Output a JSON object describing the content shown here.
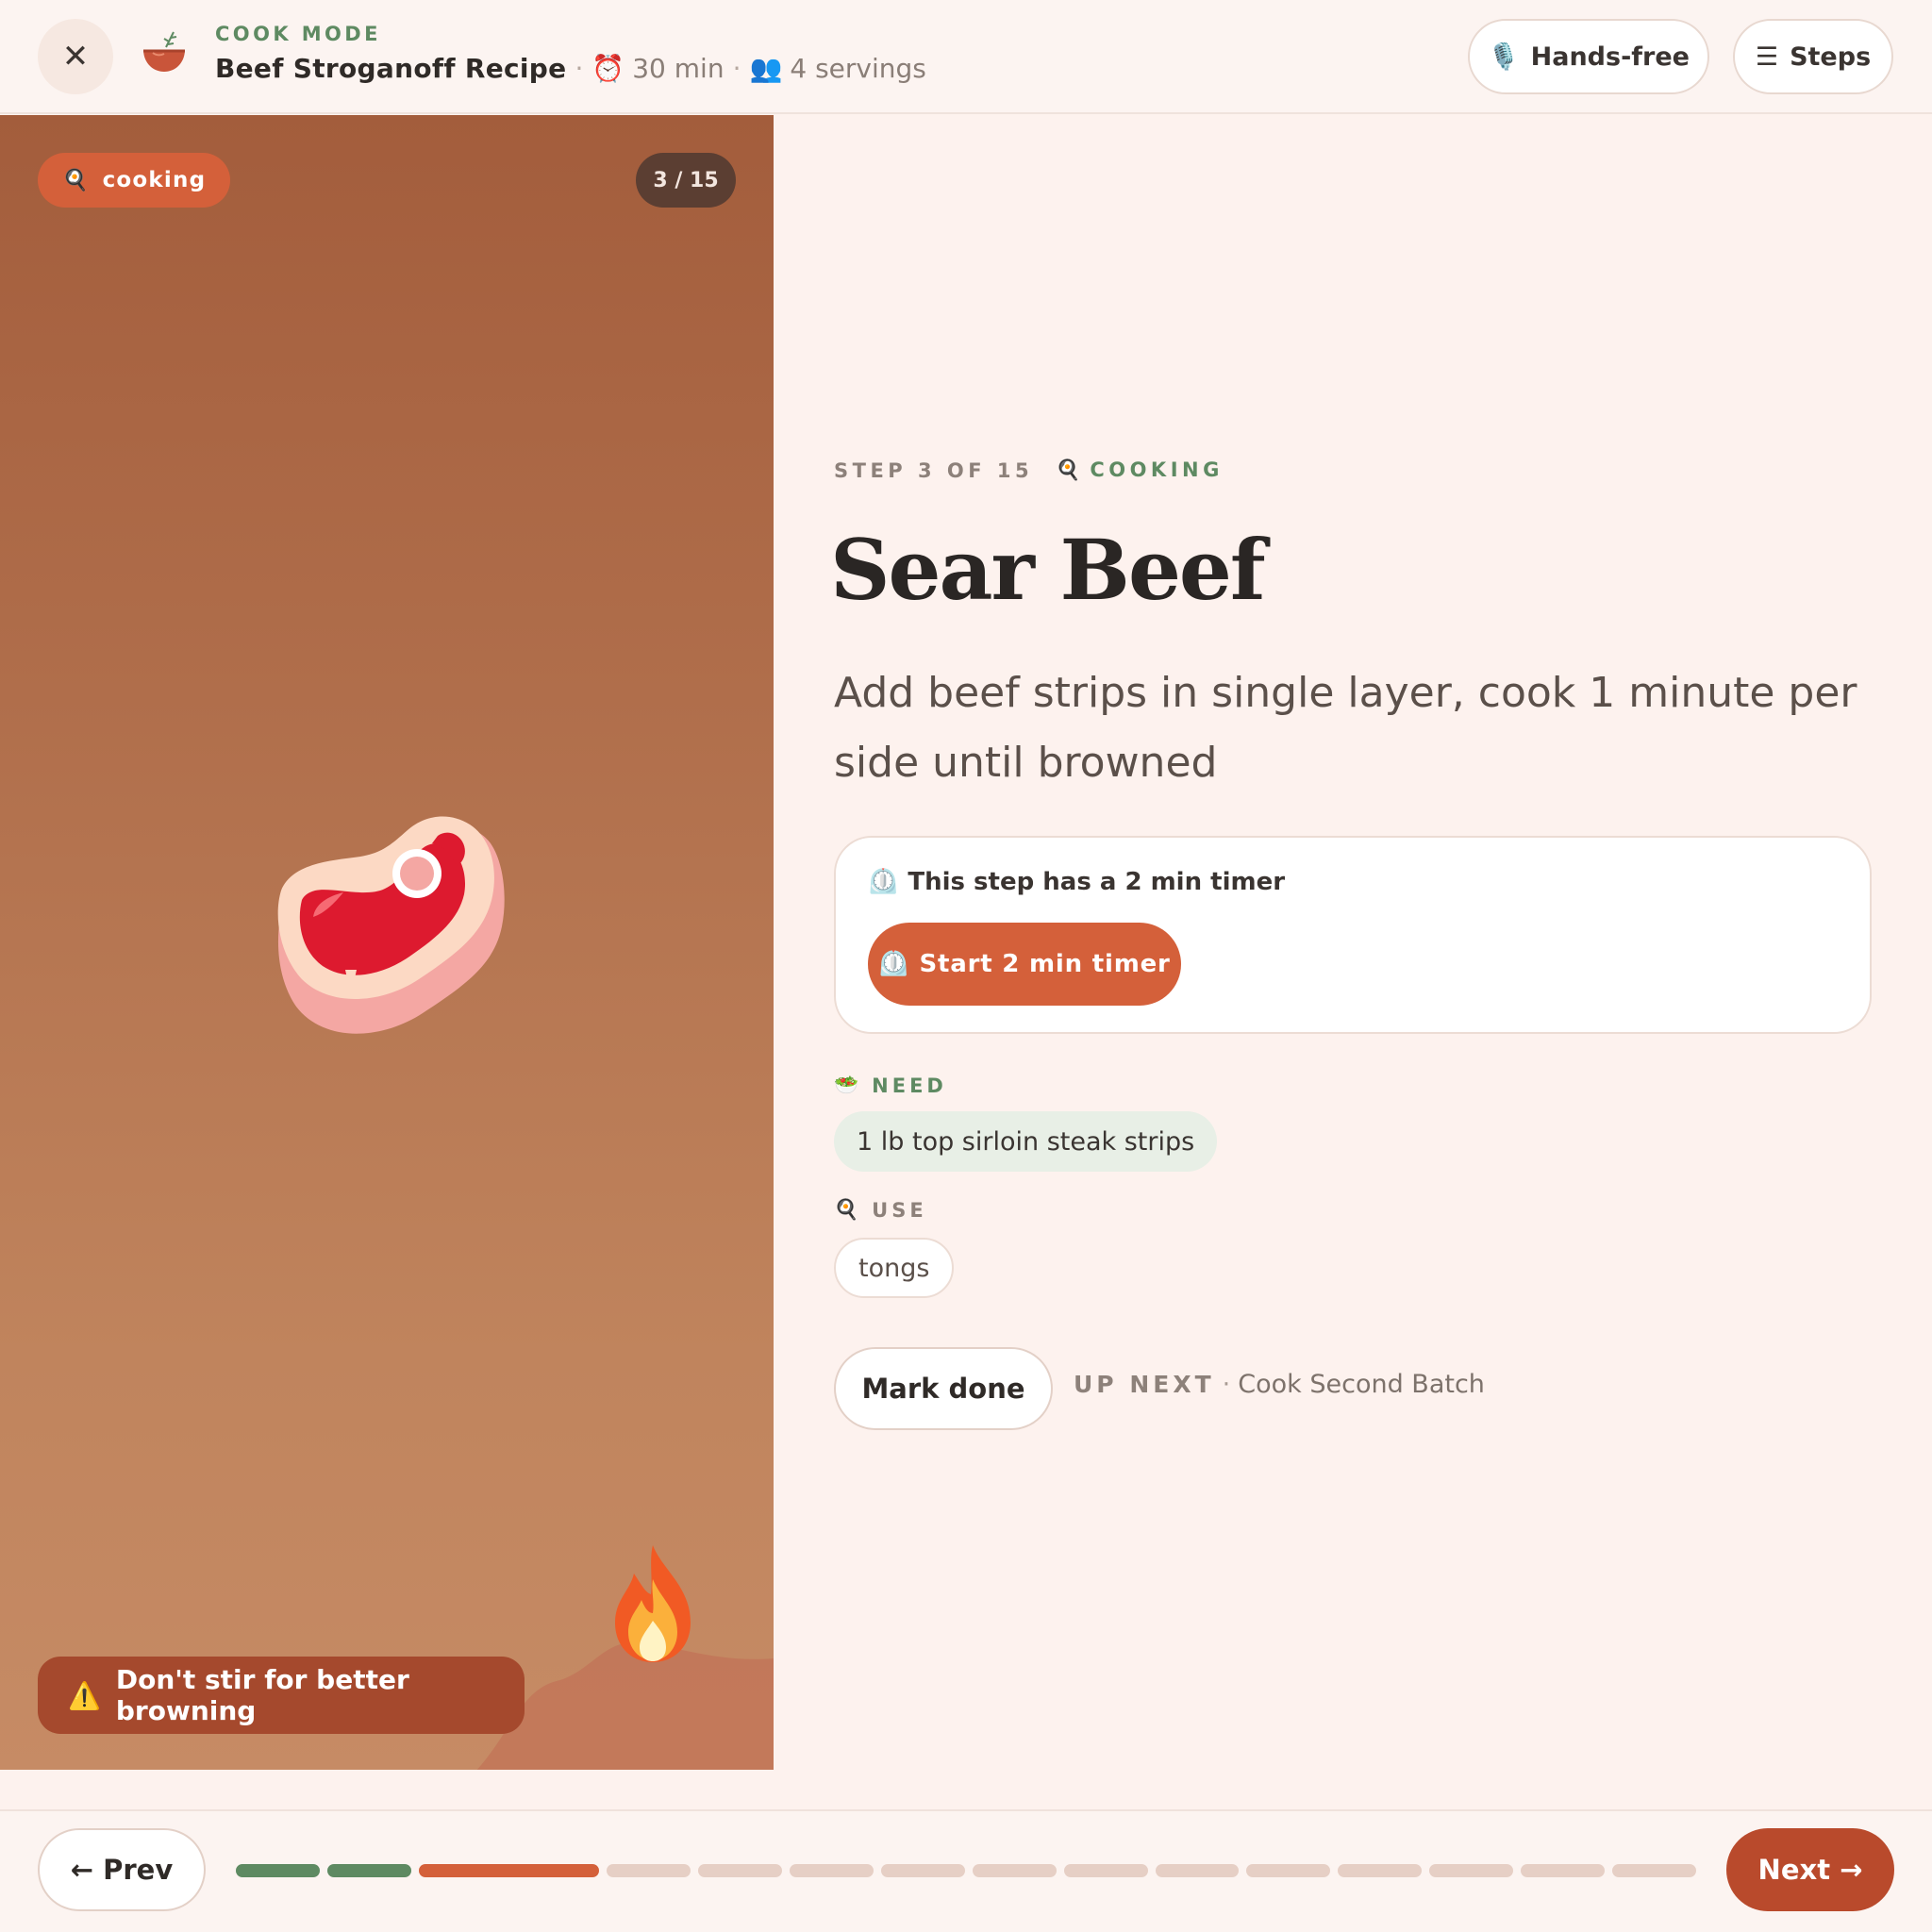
{
  "header": {
    "close_glyph": "✕",
    "mode_label": "COOK MODE",
    "recipe_title": "Beef Stroganoff Recipe",
    "sep": "·",
    "time_icon": "⏰",
    "time": "30 min",
    "servings_icon": "👥",
    "servings": "4 servings",
    "handsfree_icon": "🎙️",
    "handsfree_label": "Hands-free",
    "steps_icon": "☰",
    "steps_label": "Steps"
  },
  "visual": {
    "phase_icon": "🍳",
    "phase_badge": "cooking",
    "step_counter": "3 / 15",
    "tip_icon": "⚠️",
    "tip": "Don't stir for better browning",
    "illustration": "steak-icon",
    "accent": "flame-icon"
  },
  "step": {
    "label": "STEP 3 OF 15",
    "phase_icon": "🍳",
    "phase": "COOKING",
    "title": "Sear Beef",
    "description": "Add beef strips in single layer, cook 1 minute per side until browned",
    "timer_icon": "⏲️",
    "timer_note": "This step has a 2 min timer",
    "timer_button": "Start 2 min timer",
    "need_icon": "🥗",
    "need_label": "NEED",
    "need_items": [
      "1 lb top sirloin steak strips"
    ],
    "use_icon": "🍳",
    "use_label": "USE",
    "use_items": [
      "tongs"
    ],
    "mark_done": "Mark done",
    "up_next_label": "UP NEXT",
    "up_next_sep": "·",
    "up_next": "Cook Second Batch"
  },
  "footer": {
    "prev": "← Prev",
    "next": "Next →",
    "total_steps": 15,
    "current_step": 3
  },
  "colors": {
    "accent": "#d4603a",
    "done": "#5e8a62",
    "pending": "#e6cfc5",
    "next_button": "#b94a2c",
    "background": "#fdf2ee"
  }
}
